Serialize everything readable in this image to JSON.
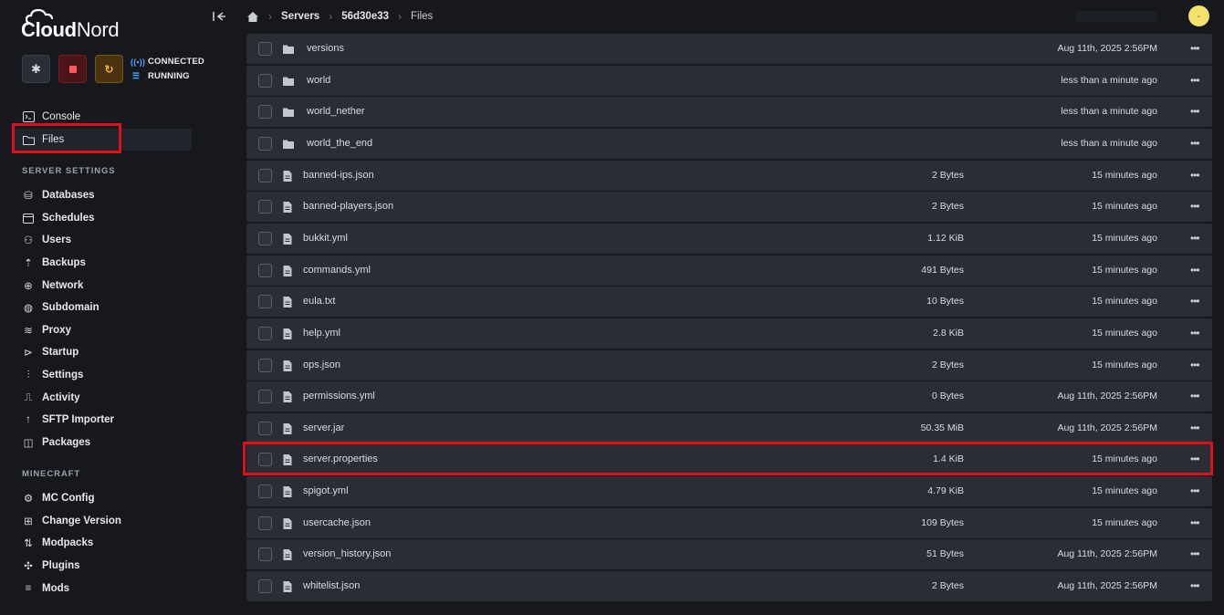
{
  "brand": {
    "name_part1": "Cloud",
    "name_part2": "Nord"
  },
  "status": {
    "connection": "CONNECTED",
    "state": "RUNNING"
  },
  "nav": {
    "console": "Console",
    "files": "Files",
    "server_settings_label": "SERVER SETTINGS",
    "databases": "Databases",
    "schedules": "Schedules",
    "users": "Users",
    "backups": "Backups",
    "network": "Network",
    "subdomain": "Subdomain",
    "proxy": "Proxy",
    "startup": "Startup",
    "settings": "Settings",
    "activity": "Activity",
    "sftp_importer": "SFTP Importer",
    "packages": "Packages",
    "minecraft_label": "MINECRAFT",
    "mc_config": "MC Config",
    "change_version": "Change Version",
    "modpacks": "Modpacks",
    "plugins": "Plugins",
    "mods": "Mods"
  },
  "breadcrumb": {
    "servers": "Servers",
    "server_id": "56d30e33",
    "current": "Files"
  },
  "files": [
    {
      "name": "versions",
      "type": "folder",
      "size": "",
      "modified": "Aug 11th, 2025 2:56PM"
    },
    {
      "name": "world",
      "type": "folder",
      "size": "",
      "modified": "less than a minute ago"
    },
    {
      "name": "world_nether",
      "type": "folder",
      "size": "",
      "modified": "less than a minute ago"
    },
    {
      "name": "world_the_end",
      "type": "folder",
      "size": "",
      "modified": "less than a minute ago"
    },
    {
      "name": "banned-ips.json",
      "type": "file",
      "size": "2 Bytes",
      "modified": "15 minutes ago"
    },
    {
      "name": "banned-players.json",
      "type": "file",
      "size": "2 Bytes",
      "modified": "15 minutes ago"
    },
    {
      "name": "bukkit.yml",
      "type": "file",
      "size": "1.12 KiB",
      "modified": "15 minutes ago"
    },
    {
      "name": "commands.yml",
      "type": "file",
      "size": "491 Bytes",
      "modified": "15 minutes ago"
    },
    {
      "name": "eula.txt",
      "type": "file",
      "size": "10 Bytes",
      "modified": "15 minutes ago"
    },
    {
      "name": "help.yml",
      "type": "file",
      "size": "2.8 KiB",
      "modified": "15 minutes ago"
    },
    {
      "name": "ops.json",
      "type": "file",
      "size": "2 Bytes",
      "modified": "15 minutes ago"
    },
    {
      "name": "permissions.yml",
      "type": "file",
      "size": "0 Bytes",
      "modified": "Aug 11th, 2025 2:56PM"
    },
    {
      "name": "server.jar",
      "type": "file",
      "size": "50.35 MiB",
      "modified": "Aug 11th, 2025 2:56PM"
    },
    {
      "name": "server.properties",
      "type": "file",
      "size": "1.4 KiB",
      "modified": "15 minutes ago"
    },
    {
      "name": "spigot.yml",
      "type": "file",
      "size": "4.79 KiB",
      "modified": "15 minutes ago"
    },
    {
      "name": "usercache.json",
      "type": "file",
      "size": "109 Bytes",
      "modified": "15 minutes ago"
    },
    {
      "name": "version_history.json",
      "type": "file",
      "size": "51 Bytes",
      "modified": "Aug 11th, 2025 2:56PM"
    },
    {
      "name": "whitelist.json",
      "type": "file",
      "size": "2 Bytes",
      "modified": "Aug 11th, 2025 2:56PM"
    }
  ],
  "colors": {
    "highlight": "#e0101a",
    "accent_blue": "#4aa3ff",
    "stop": "#ff5b63",
    "restart": "#f3b33b"
  },
  "icons": {
    "settings": "gear-icon",
    "stop": "stop-icon",
    "restart": "refresh-icon",
    "more": "more-horizontal-icon"
  }
}
